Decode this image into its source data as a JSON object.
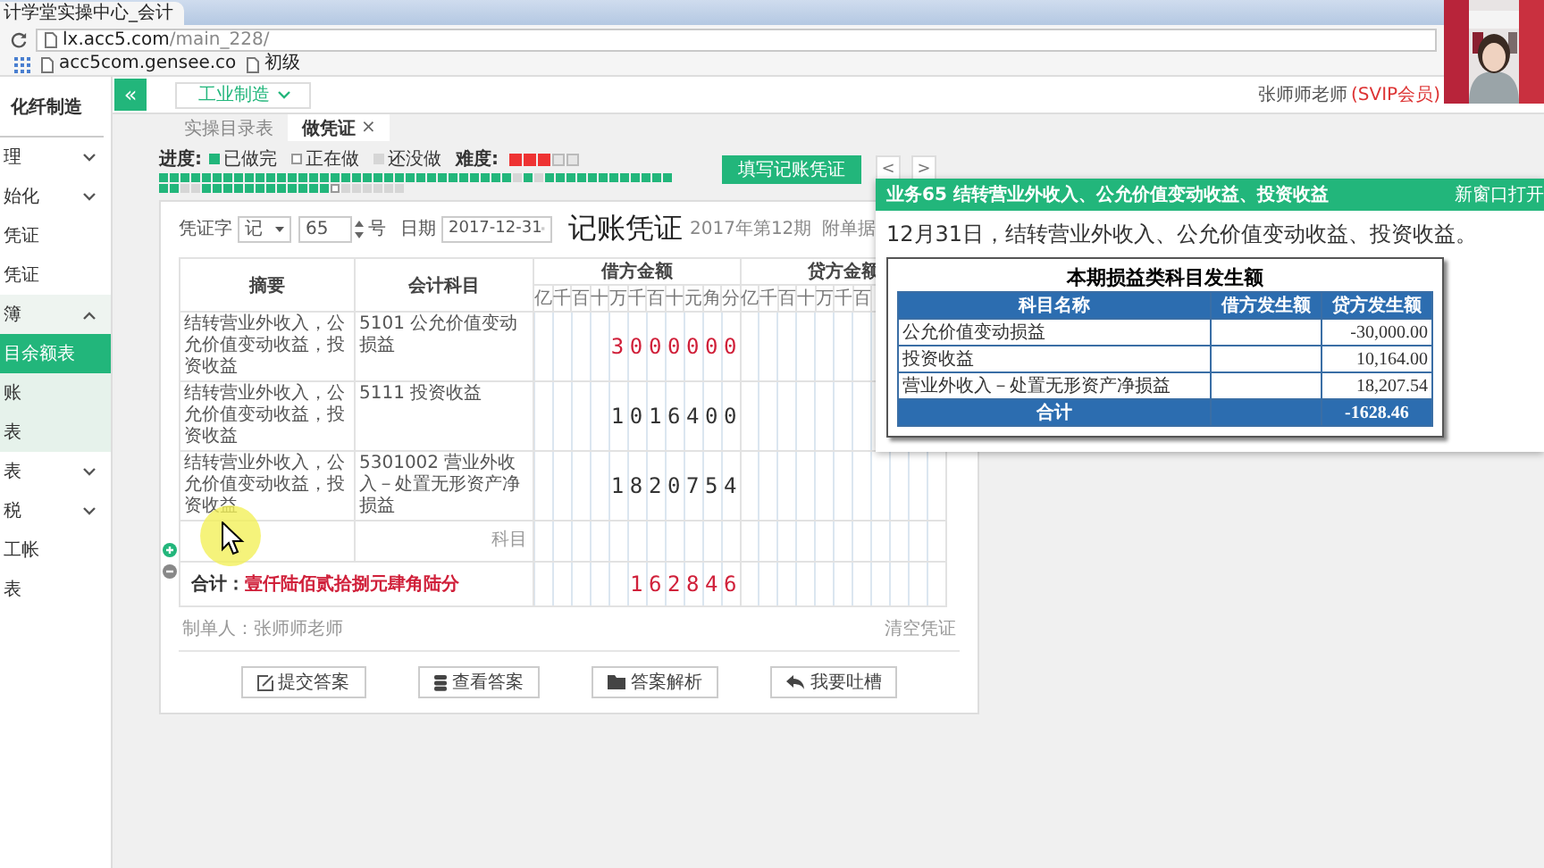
{
  "browser": {
    "tab_title": "计学堂实操中心_会计",
    "address_host": "lx.acc5.com",
    "address_path": "/main_228/",
    "bookmarks": [
      "acc5com.gensee.co",
      "初级"
    ]
  },
  "header": {
    "collapse": "«",
    "industry": "工业制造",
    "user": "张师师老师",
    "member": "(SVIP会员)"
  },
  "sidebar": {
    "title": "化纤制造",
    "items": [
      {
        "label": "理",
        "kind": "group",
        "expanded": false
      },
      {
        "label": "始化",
        "kind": "group",
        "expanded": false
      },
      {
        "label": "凭证",
        "kind": "link",
        "selected": false
      },
      {
        "label": "凭证",
        "kind": "link",
        "selected": false
      },
      {
        "label": "簿",
        "kind": "group",
        "expanded": true,
        "children": [
          {
            "label": "目余额表",
            "selected": true
          },
          {
            "label": "账",
            "selected": false
          },
          {
            "label": "表",
            "selected": false
          }
        ]
      },
      {
        "label": "表",
        "kind": "group",
        "expanded": false
      },
      {
        "label": "税",
        "kind": "group",
        "expanded": false
      },
      {
        "label": "工帐",
        "kind": "link",
        "selected": false
      },
      {
        "label": "表",
        "kind": "link",
        "selected": false
      }
    ]
  },
  "tabs": [
    {
      "label": "实操目录表",
      "selected": false
    },
    {
      "label": "做凭证",
      "selected": true,
      "close": "×"
    }
  ],
  "progress": {
    "label": "进度:",
    "legend": [
      {
        "label": "已做完",
        "kind": "done"
      },
      {
        "label": "正在做",
        "kind": "current"
      },
      {
        "label": "还没做",
        "kind": "todo"
      }
    ],
    "difficulty_label": "难度:",
    "stars": 3,
    "cells": [
      {
        "kind": "done"
      },
      {
        "kind": "done"
      },
      {
        "kind": "done"
      },
      {
        "kind": "done"
      },
      {
        "kind": "done"
      },
      {
        "kind": "done"
      },
      {
        "kind": "done"
      },
      {
        "kind": "done"
      },
      {
        "kind": "done"
      },
      {
        "kind": "done"
      },
      {
        "kind": "done"
      },
      {
        "kind": "done"
      },
      {
        "kind": "done"
      },
      {
        "kind": "done"
      },
      {
        "kind": "done"
      },
      {
        "kind": "done"
      },
      {
        "kind": "done"
      },
      {
        "kind": "done"
      },
      {
        "kind": "done"
      },
      {
        "kind": "done"
      },
      {
        "kind": "done"
      },
      {
        "kind": "done"
      },
      {
        "kind": "done"
      },
      {
        "kind": "done"
      },
      {
        "kind": "done"
      },
      {
        "kind": "done"
      },
      {
        "kind": "done"
      },
      {
        "kind": "done"
      },
      {
        "kind": "done"
      },
      {
        "kind": "done"
      },
      {
        "kind": "done"
      },
      {
        "kind": "done"
      },
      {
        "kind": "done"
      },
      {
        "kind": "todo"
      },
      {
        "kind": "done"
      },
      {
        "kind": "todo"
      },
      {
        "kind": "done"
      },
      {
        "kind": "done"
      },
      {
        "kind": "done"
      },
      {
        "kind": "done"
      },
      {
        "kind": "done"
      },
      {
        "kind": "done"
      },
      {
        "kind": "done"
      },
      {
        "kind": "done"
      },
      {
        "kind": "done"
      },
      {
        "kind": "done"
      },
      {
        "kind": "done"
      },
      {
        "kind": "done"
      },
      {
        "kind": "done"
      },
      {
        "kind": "done"
      },
      {
        "kind": "todo"
      },
      {
        "kind": "todo"
      },
      {
        "kind": "done"
      },
      {
        "kind": "done"
      },
      {
        "kind": "done"
      },
      {
        "kind": "done"
      },
      {
        "kind": "done"
      },
      {
        "kind": "done"
      },
      {
        "kind": "done"
      },
      {
        "kind": "done"
      },
      {
        "kind": "done"
      },
      {
        "kind": "done"
      },
      {
        "kind": "done"
      },
      {
        "kind": "done"
      },
      {
        "kind": "current"
      },
      {
        "kind": "todo"
      },
      {
        "kind": "todo"
      },
      {
        "kind": "todo"
      },
      {
        "kind": "todo"
      },
      {
        "kind": "todo"
      },
      {
        "kind": "todo"
      }
    ]
  },
  "fill_button": "填写记账凭证",
  "nav": [
    "<",
    ">"
  ],
  "voucher": {
    "type_label": "凭证字",
    "type_value": "记",
    "number": "65",
    "number_suffix": "号",
    "date_label": "日期",
    "date": "2017-12-31",
    "title": "记账凭证",
    "period": "2017年第12期",
    "attachments_label": "附单据",
    "summary_header": "摘要",
    "account_header": "会计科目",
    "debit_header": "借方金额",
    "credit_header": "贷方金额",
    "debit_units": [
      "亿",
      "千",
      "百",
      "十",
      "万",
      "千",
      "百",
      "十",
      "元",
      "角",
      "分"
    ],
    "credit_units": [
      "亿",
      "千",
      "百",
      "十",
      "万",
      "千",
      "百"
    ],
    "rows": [
      {
        "summary": "结转营业外收入，公允价值变动收益，投资收益",
        "account": "5101 公允价值变动损益",
        "debit": "3000000",
        "negative": true
      },
      {
        "summary": "结转营业外收入，公允价值变动收益，投资收益",
        "account": "5111 投资收益",
        "debit": "1016400",
        "negative": false
      },
      {
        "summary": "结转营业外收入，公允价值变动收益，投资收益",
        "account": "5301002 营业外收入－处置无形资产净损益",
        "debit": "1820754",
        "negative": false
      }
    ],
    "account_placeholder": "科目",
    "total": {
      "label": "合计：",
      "words": "壹仟陆佰贰拾捌元肆角陆分",
      "debit": "162846",
      "negative": true
    },
    "preparer": "制单人：张师师老师",
    "clear": "清空凭证",
    "buttons": [
      "提交答案",
      "查看答案",
      "答案解析",
      "我要吐槽"
    ]
  },
  "popup": {
    "title": "业务65 结转营业外收入、公允价值变动收益、投资收益",
    "open_new": "新窗口打开",
    "text": "12月31日，结转营业外收入、公允价值变动收益、投资收益。",
    "table": {
      "title": "本期损益类科目发生额",
      "columns": [
        "科目名称",
        "借方发生额",
        "贷方发生额"
      ],
      "rows": [
        {
          "name": "公允价值变动损益",
          "credit": "-30,000.00"
        },
        {
          "name": "投资收益",
          "credit": "10,164.00"
        },
        {
          "name": "营业外收入－处置无形资产净损益",
          "credit": "18,207.54"
        }
      ],
      "total": {
        "label": "合计",
        "credit": "-1628.46"
      }
    }
  }
}
